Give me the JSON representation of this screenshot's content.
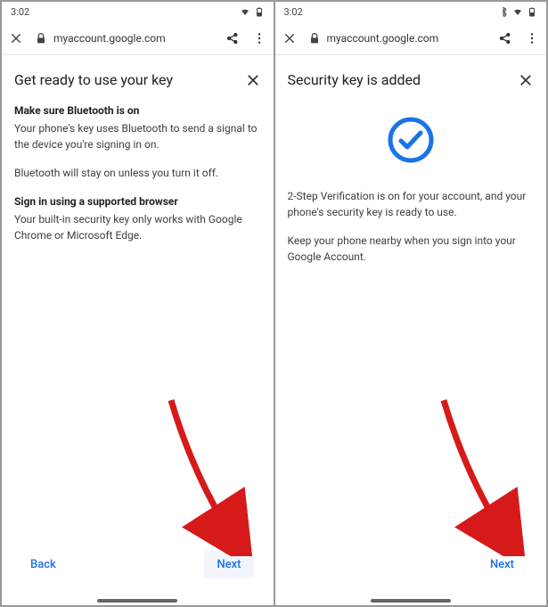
{
  "status": {
    "time": "3:02",
    "bluetooth_shown_right": true
  },
  "browser": {
    "url": "myaccount.google.com"
  },
  "screens": [
    {
      "title": "Get ready to use your key",
      "heading1": "Make sure Bluetooth is on",
      "body1": "Your phone's key uses Bluetooth to send a signal to the device you're signing in on.",
      "body2": "Bluetooth will stay on unless you turn it off.",
      "heading2": "Sign in using a supported browser",
      "body3": "Your built-in security key only works with Google Chrome or Microsoft Edge.",
      "back_label": "Back",
      "next_label": "Next"
    },
    {
      "title": "Security key is added",
      "body1": "2-Step Verification is on for your account, and your phone's security key is ready to use.",
      "body2": "Keep your phone nearby when you sign into your Google Account.",
      "next_label": "Next"
    }
  ],
  "colors": {
    "link_blue": "#1a73e8",
    "hero_blue": "#1a73e8",
    "arrow_red": "#d61a1a"
  }
}
